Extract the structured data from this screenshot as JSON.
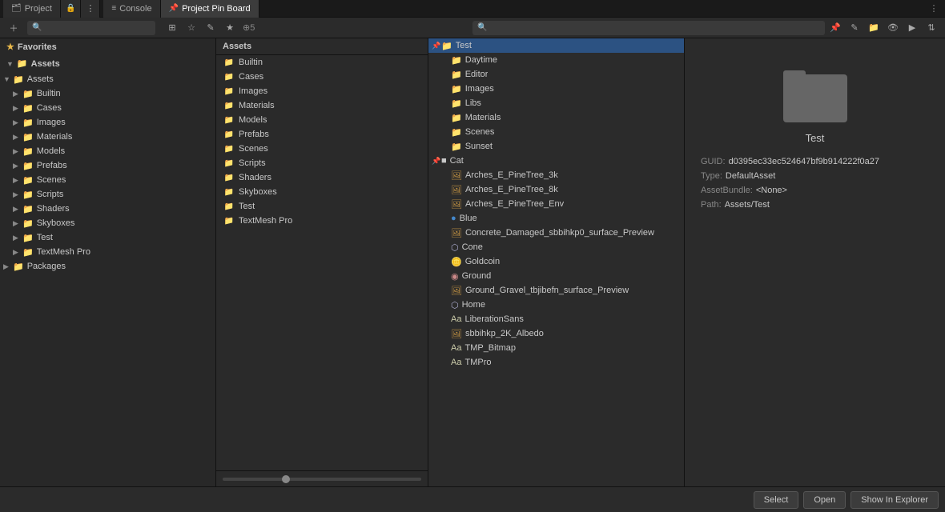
{
  "tabs": [
    {
      "id": "project",
      "label": "Project",
      "icon": "🗂",
      "active": false
    },
    {
      "id": "console",
      "label": "Console",
      "icon": "≡",
      "active": false
    },
    {
      "id": "pinboard",
      "label": "Project Pin Board",
      "icon": "📌",
      "active": true
    }
  ],
  "toolbar": {
    "search_placeholder": "",
    "pin_search_placeholder": ""
  },
  "favorites": {
    "label": "Favorites"
  },
  "assets_tree": {
    "label": "Assets",
    "items": [
      {
        "id": "assets-root",
        "label": "Assets",
        "indent": 0,
        "expanded": true,
        "is_folder": true
      },
      {
        "id": "builtin",
        "label": "Builtin",
        "indent": 1,
        "expanded": false,
        "is_folder": true
      },
      {
        "id": "cases",
        "label": "Cases",
        "indent": 1,
        "expanded": false,
        "is_folder": true
      },
      {
        "id": "images",
        "label": "Images",
        "indent": 1,
        "expanded": false,
        "is_folder": true
      },
      {
        "id": "materials",
        "label": "Materials",
        "indent": 1,
        "expanded": false,
        "is_folder": true
      },
      {
        "id": "models",
        "label": "Models",
        "indent": 1,
        "expanded": false,
        "is_folder": true
      },
      {
        "id": "prefabs",
        "label": "Prefabs",
        "indent": 1,
        "expanded": false,
        "is_folder": true
      },
      {
        "id": "scenes",
        "label": "Scenes",
        "indent": 1,
        "expanded": false,
        "is_folder": true
      },
      {
        "id": "scripts",
        "label": "Scripts",
        "indent": 1,
        "expanded": false,
        "is_folder": true
      },
      {
        "id": "shaders",
        "label": "Shaders",
        "indent": 1,
        "expanded": false,
        "is_folder": true
      },
      {
        "id": "skyboxes",
        "label": "Skyboxes",
        "indent": 1,
        "expanded": false,
        "is_folder": true
      },
      {
        "id": "test",
        "label": "Test",
        "indent": 1,
        "expanded": false,
        "is_folder": true
      },
      {
        "id": "textmesh",
        "label": "TextMesh Pro",
        "indent": 1,
        "expanded": false,
        "is_folder": true
      },
      {
        "id": "packages",
        "label": "Packages",
        "indent": 0,
        "expanded": false,
        "is_folder": true
      }
    ]
  },
  "assets_middle": {
    "label": "Assets",
    "items": [
      {
        "id": "builtin2",
        "label": "Builtin",
        "icon": "folder",
        "indent": 0
      },
      {
        "id": "cases2",
        "label": "Cases",
        "icon": "folder",
        "indent": 0
      },
      {
        "id": "images2",
        "label": "Images",
        "icon": "folder",
        "indent": 0
      },
      {
        "id": "materials2",
        "label": "Materials",
        "icon": "folder",
        "indent": 0
      },
      {
        "id": "models2",
        "label": "Models",
        "icon": "folder",
        "indent": 0
      },
      {
        "id": "prefabs2",
        "label": "Prefabs",
        "icon": "folder",
        "indent": 0
      },
      {
        "id": "scenes2",
        "label": "Scenes",
        "icon": "folder",
        "indent": 0
      },
      {
        "id": "scripts2",
        "label": "Scripts",
        "icon": "folder",
        "indent": 0
      },
      {
        "id": "shaders2",
        "label": "Shaders",
        "icon": "folder",
        "indent": 0
      },
      {
        "id": "skyboxes2",
        "label": "Skyboxes",
        "icon": "folder",
        "indent": 0
      },
      {
        "id": "test2",
        "label": "Test",
        "icon": "folder",
        "indent": 0
      },
      {
        "id": "textmesh2",
        "label": "TextMesh Pro",
        "icon": "folder",
        "indent": 0
      }
    ]
  },
  "pinboard": {
    "title": "Project Pin Board",
    "tree_items": [
      {
        "id": "test-root",
        "label": "Test",
        "indent": 0,
        "selected": true,
        "is_folder": true,
        "pin": true
      },
      {
        "id": "daytime",
        "label": "Daytime",
        "indent": 1,
        "is_folder": true
      },
      {
        "id": "editor",
        "label": "Editor",
        "indent": 1,
        "is_folder": true
      },
      {
        "id": "images-pin",
        "label": "Images",
        "indent": 1,
        "is_folder": true
      },
      {
        "id": "libs",
        "label": "Libs",
        "indent": 1,
        "is_folder": true
      },
      {
        "id": "materials-pin",
        "label": "Materials",
        "indent": 1,
        "is_folder": true
      },
      {
        "id": "scenes-pin",
        "label": "Scenes",
        "indent": 1,
        "is_folder": true
      },
      {
        "id": "sunset",
        "label": "Sunset",
        "indent": 1,
        "is_folder": true
      },
      {
        "id": "cat",
        "label": "Cat",
        "indent": 0,
        "is_folder": false,
        "pin": true
      },
      {
        "id": "arches3k",
        "label": "Arches_E_PineTree_3k",
        "indent": 1,
        "icon": "texture"
      },
      {
        "id": "arches8k",
        "label": "Arches_E_PineTree_8k",
        "indent": 1,
        "icon": "texture"
      },
      {
        "id": "archesenv",
        "label": "Arches_E_PineTree_Env",
        "indent": 1,
        "icon": "texture"
      },
      {
        "id": "blue",
        "label": "Blue",
        "indent": 1,
        "icon": "sphere"
      },
      {
        "id": "concrete",
        "label": "Concrete_Damaged_sbbihkp0_surface_Preview",
        "indent": 1,
        "icon": "texture"
      },
      {
        "id": "cone",
        "label": "Cone",
        "indent": 1,
        "icon": "mesh"
      },
      {
        "id": "goldcoin",
        "label": "Goldcoin",
        "indent": 1,
        "icon": "coin"
      },
      {
        "id": "ground",
        "label": "Ground",
        "indent": 1,
        "icon": "material"
      },
      {
        "id": "ground-gravel",
        "label": "Ground_Gravel_tbjibefn_surface_Preview",
        "indent": 1,
        "icon": "texture"
      },
      {
        "id": "home",
        "label": "Home",
        "indent": 1,
        "icon": "mesh"
      },
      {
        "id": "liberation",
        "label": "LiberationSans",
        "indent": 1,
        "icon": "font"
      },
      {
        "id": "sbbihkp",
        "label": "sbbihkp_2K_Albedo",
        "indent": 1,
        "icon": "texture"
      },
      {
        "id": "tmp-bitmap",
        "label": "TMP_Bitmap",
        "indent": 1,
        "icon": "font"
      },
      {
        "id": "tmpro",
        "label": "TMPro",
        "indent": 1,
        "icon": "font"
      }
    ],
    "selected_asset": {
      "name": "Test",
      "guid": "d0395ec33ec524647bf9b914222f0a27",
      "type": "DefaultAsset",
      "asset_bundle": "<None>",
      "path": "Assets/Test"
    }
  },
  "buttons": {
    "select": "Select",
    "open": "Open",
    "show_explorer": "Show In Explorer"
  }
}
